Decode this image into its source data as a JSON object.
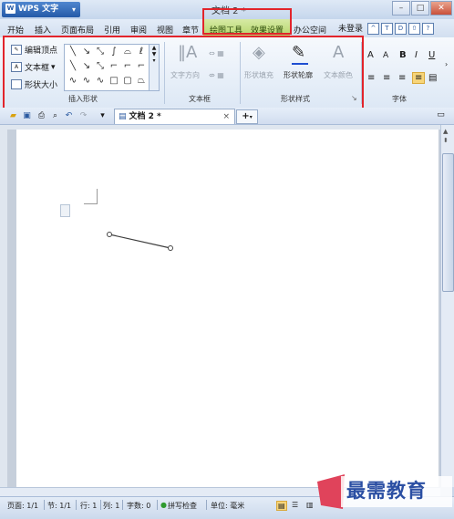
{
  "app": {
    "name": "WPS 文字",
    "logo": "W",
    "doc_title": "文档 2 *"
  },
  "window_controls": {
    "minimize": "–",
    "maximize": "□",
    "close": "✕"
  },
  "menu_tabs": [
    "开始",
    "插入",
    "页面布局",
    "引用",
    "审阅",
    "视图",
    "章节"
  ],
  "context_tabs": [
    "绘图工具",
    "效果设置"
  ],
  "extra_tabs": [
    "办公空间"
  ],
  "account": {
    "login": "未登录"
  },
  "ribbon": {
    "edit_points": "编辑顶点",
    "text_box": "文本框",
    "shape_size": "形状大小",
    "group_insert_shape": "插入形状",
    "text_direction": "文字方向",
    "group_text_box": "文本框",
    "shape_fill": "形状填充",
    "shape_outline": "形状轮廓",
    "text_color": "文本颜色",
    "group_shape_style": "形状样式",
    "group_font": "字体",
    "font_buttons": [
      "A",
      "A",
      "B",
      "I",
      "U"
    ]
  },
  "doc_tab": {
    "label": "文档 2 *",
    "close": "×",
    "new": "+"
  },
  "status": {
    "page": "页面: 1/1",
    "section": "节: 1/1",
    "row": "行: 1",
    "col": "列: 1",
    "words": "字数: 0",
    "spell": "拼写检查",
    "unit": "单位: 毫米"
  },
  "watermark": "最需教育",
  "colors": {
    "highlight_border": "#e2242b",
    "context_tab_bg": "#c2df7a",
    "accent": "#245aa8"
  }
}
